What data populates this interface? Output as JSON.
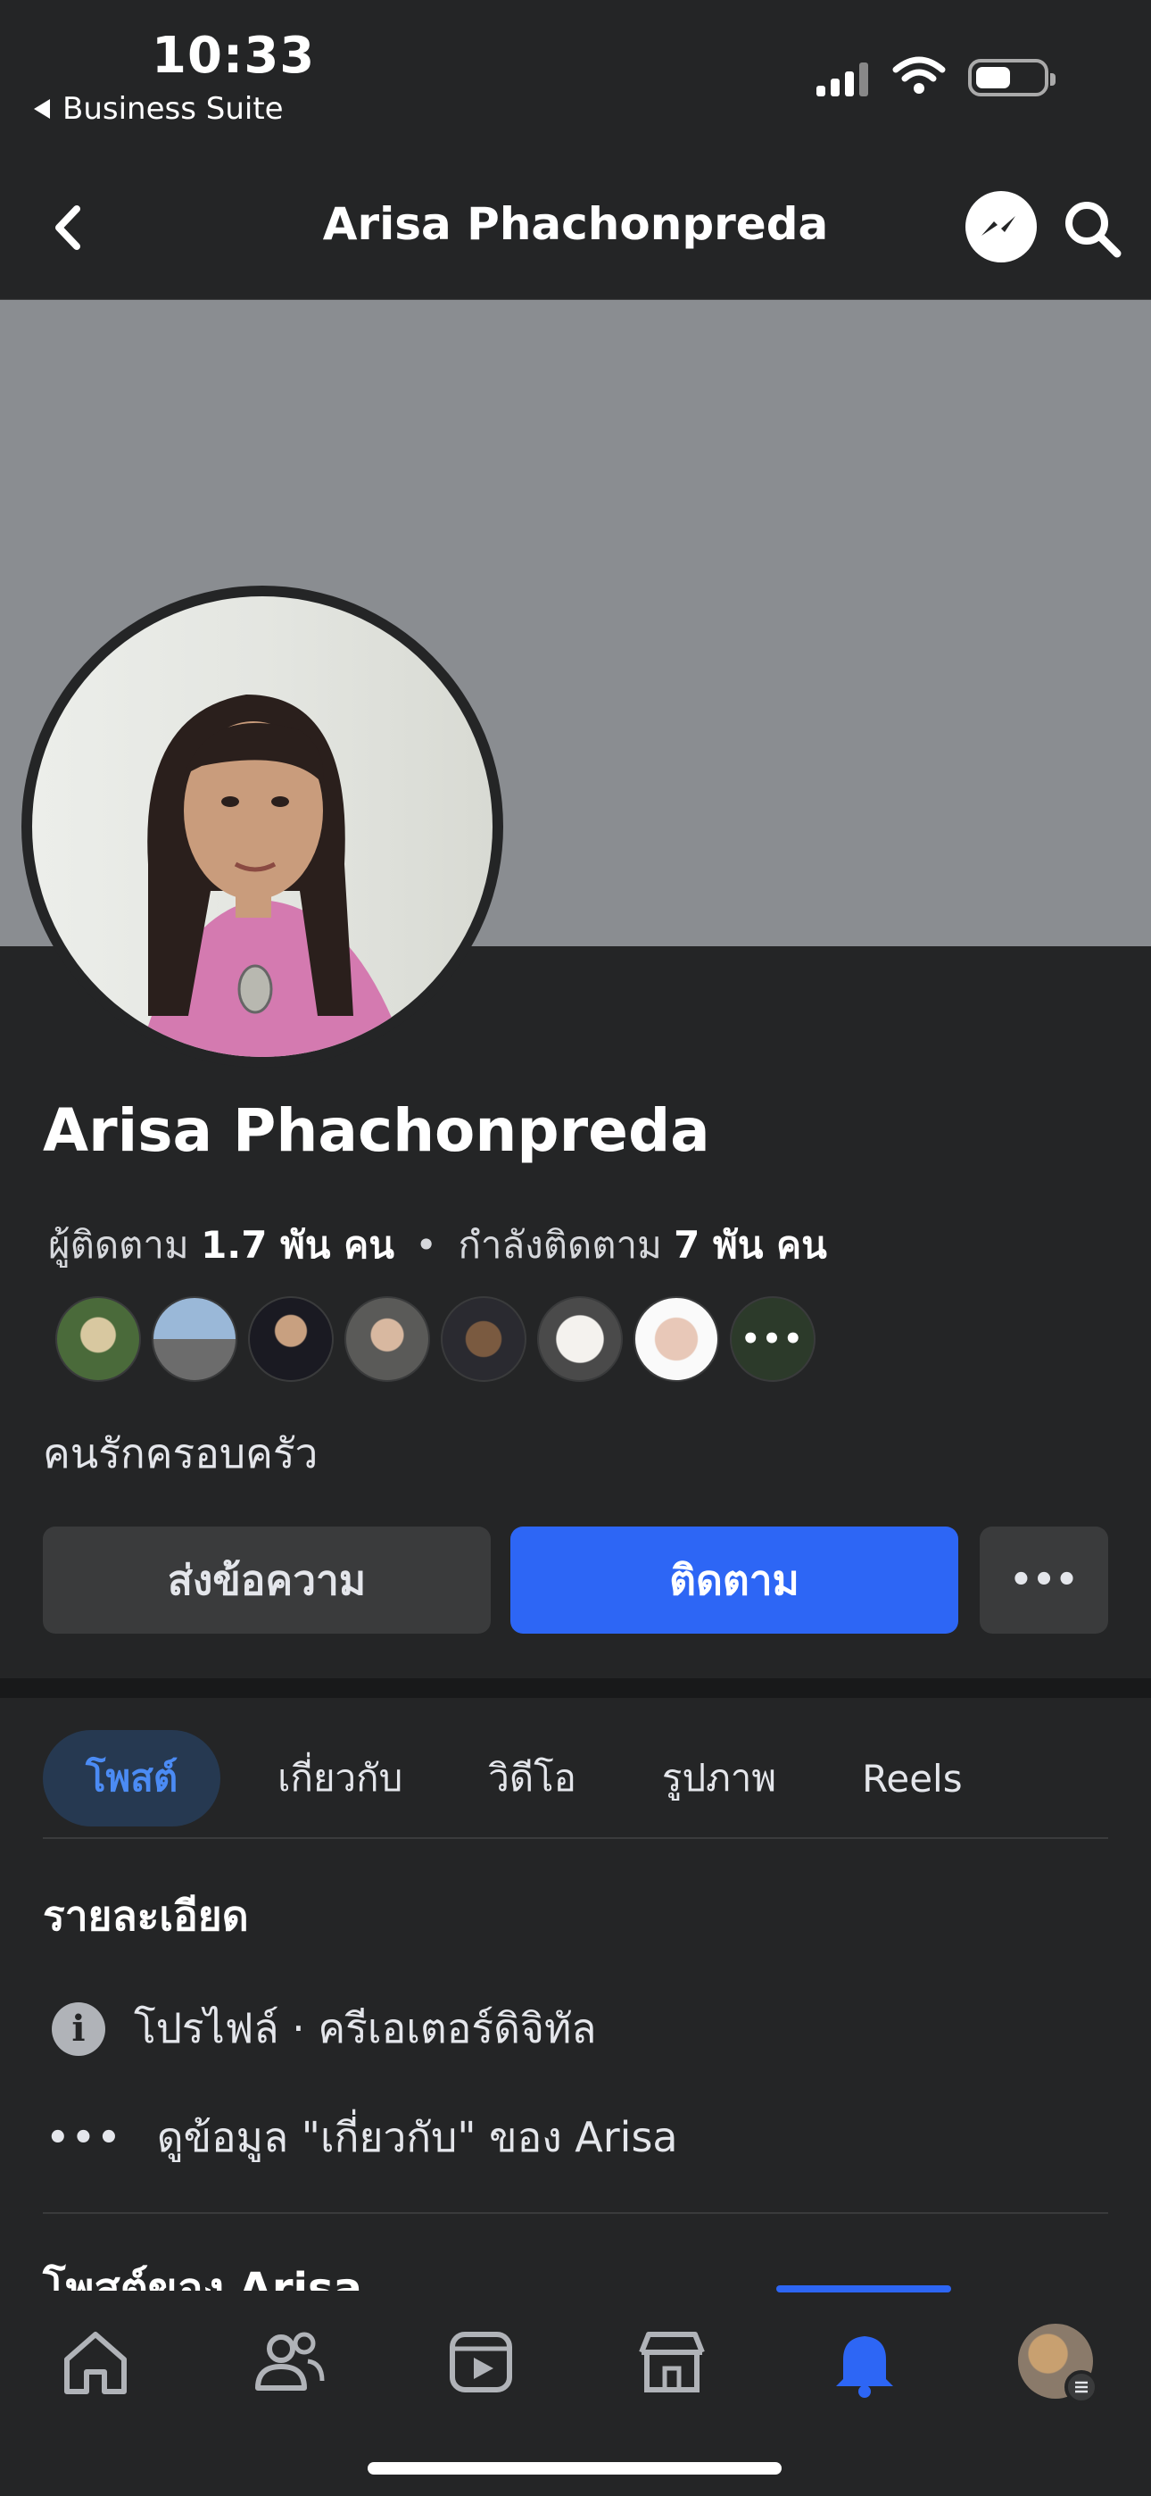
{
  "status_bar": {
    "time": "10:33",
    "back_app_label": "Business Suite"
  },
  "header": {
    "title": "Arisa Phachonpreda"
  },
  "profile": {
    "name": "Arisa Phachonpreda",
    "followers_label": "ผู้ติดตาม",
    "followers_count": "1.7 พัน คน",
    "separator": "•",
    "following_label": "กำลังติดตาม",
    "following_count": "7 พัน คน",
    "bio": "คนรักครอบครัว",
    "friends_more_label": "•••"
  },
  "actions": {
    "message_label": "ส่งข้อความ",
    "follow_label": "ติดตาม",
    "more_label": "•••"
  },
  "tabs": [
    {
      "label": "โพสต์"
    },
    {
      "label": "เกี่ยวกับ"
    },
    {
      "label": "วิดีโอ"
    },
    {
      "label": "รูปภาพ"
    },
    {
      "label": "Reels"
    }
  ],
  "details": {
    "title": "รายละเอียด",
    "info_icon_glyph": "i",
    "profile_type": "โปรไฟล์ · ครีเอเตอร์ดิจิทัล",
    "about_dots": "•••",
    "about_link": "ดูข้อมูล \"เกี่ยวกับ\" ของ Arisa"
  },
  "posts": {
    "title": "โพสต์ของ Arisa"
  },
  "colors": {
    "accent": "#2d66f5",
    "background": "#242526",
    "cover": "#8a8d91"
  },
  "icons": {
    "nav": [
      "home-icon",
      "friends-icon",
      "video-icon",
      "marketplace-icon",
      "notifications-icon",
      "menu-avatar-icon"
    ],
    "active_nav": "notifications-icon"
  }
}
